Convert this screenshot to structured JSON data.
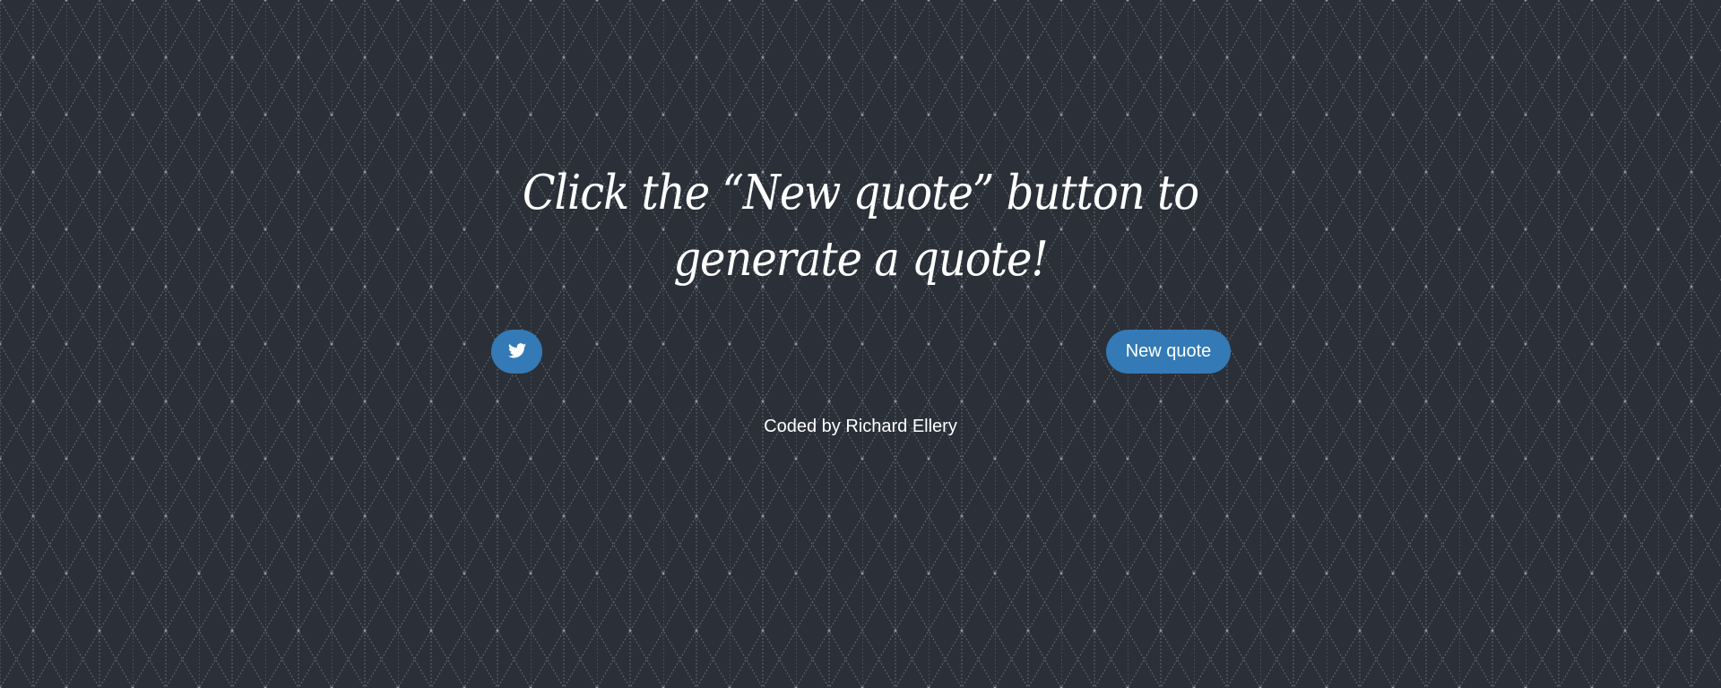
{
  "quote": {
    "text": "Click the “New quote” button to generate a quote!"
  },
  "buttons": {
    "tweet_icon": "twitter-icon",
    "new_quote_label": "New quote"
  },
  "footer": {
    "credit": "Coded by Richard Ellery"
  },
  "colors": {
    "background": "#2b3038",
    "button": "#337ab7",
    "text": "#ffffff"
  }
}
